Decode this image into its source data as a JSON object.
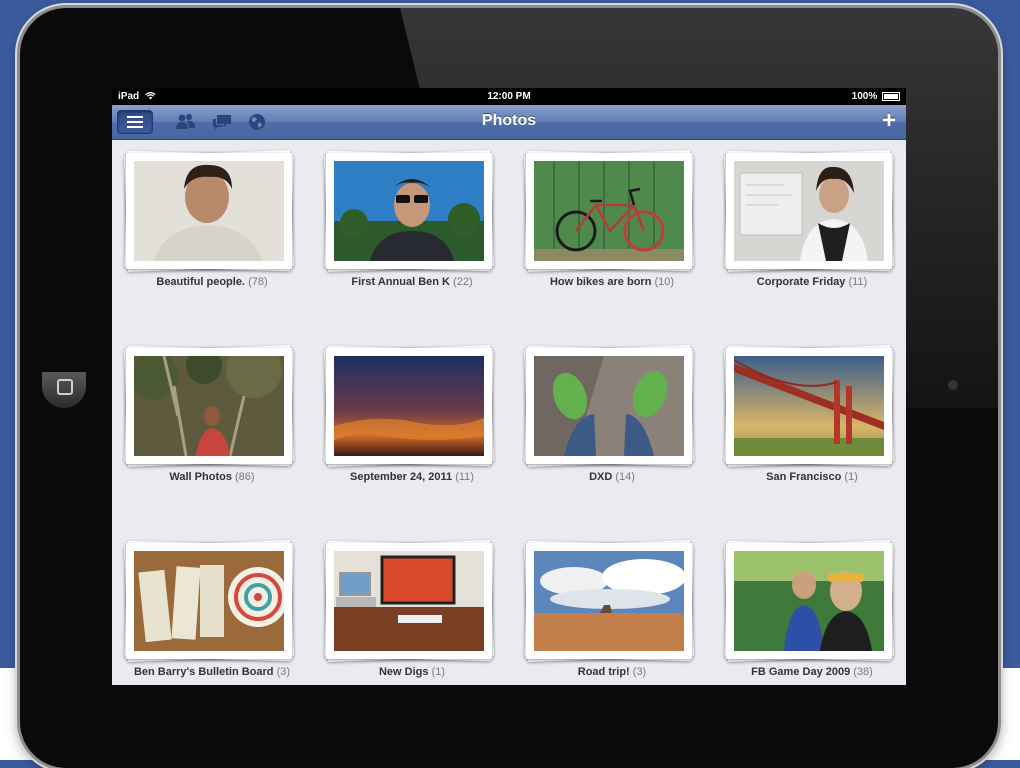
{
  "status_bar": {
    "device": "iPad",
    "time": "12:00 PM",
    "battery": "100%"
  },
  "nav": {
    "title": "Photos",
    "add_label": "+",
    "icons": [
      "menu-icon",
      "friends-icon",
      "messages-icon",
      "globe-icon"
    ]
  },
  "albums": [
    {
      "name": "Beautiful people.",
      "count": "(78)"
    },
    {
      "name": "First Annual Ben K",
      "count": "(22)"
    },
    {
      "name": "How bikes are born",
      "count": "(10)"
    },
    {
      "name": "Corporate Friday",
      "count": "(11)"
    },
    {
      "name": "Wall Photos",
      "count": "(86)"
    },
    {
      "name": "September 24, 2011",
      "count": "(11)"
    },
    {
      "name": "DXD",
      "count": "(14)"
    },
    {
      "name": "San Francisco",
      "count": "(1)"
    },
    {
      "name": "Ben Barry's Bulletin Board",
      "count": "(3)"
    },
    {
      "name": "New Digs",
      "count": "(1)"
    },
    {
      "name": "Road trip!",
      "count": "(3)"
    },
    {
      "name": "FB Game Day 2009",
      "count": "(38)"
    }
  ],
  "colors": {
    "background": "#3b5b9f",
    "navbar": "#5f7cb6",
    "screen": "#e9ebf0"
  }
}
